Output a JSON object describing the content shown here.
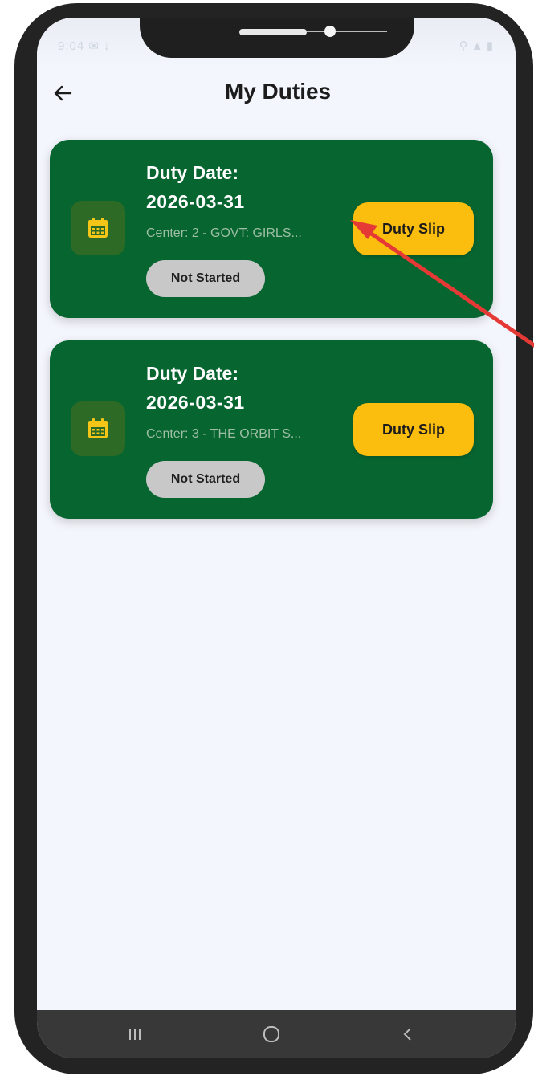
{
  "status_bar": {
    "time": "9:04 ✉ ↓",
    "right": "⚲ ▲ ▮"
  },
  "header": {
    "title": "My Duties"
  },
  "duties": [
    {
      "date_label": "Duty Date:",
      "date_value": "2026-03-31",
      "center": "Center: 2 - GOVT: GIRLS...",
      "status": "Not Started",
      "action_label": "Duty Slip"
    },
    {
      "date_label": "Duty Date:",
      "date_value": "2026-03-31",
      "center": "Center: 3 - THE ORBIT S...",
      "status": "Not Started",
      "action_label": "Duty Slip"
    }
  ],
  "navigation": {
    "recents_icon": "recents-icon",
    "home_icon": "home-icon",
    "back_icon": "back-icon"
  },
  "colors": {
    "card_background": "#076530",
    "button_accent": "#fbbd0e",
    "status_pill": "#c8c8c8",
    "annotation_arrow": "#e53935"
  }
}
